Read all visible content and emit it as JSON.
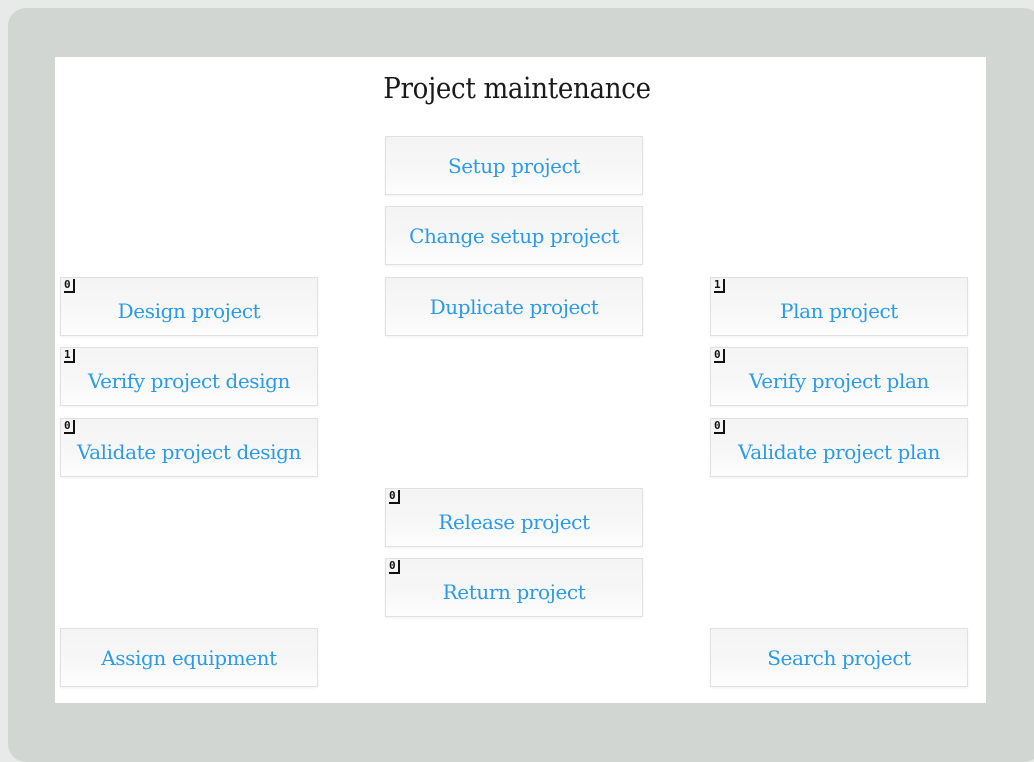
{
  "page": {
    "title": "Project maintenance"
  },
  "colors": {
    "link_text": "#2b9be8",
    "frame": "#d2d6d3",
    "panel": "#ffffff"
  },
  "tiles": {
    "setup_project": {
      "label": "Setup project"
    },
    "change_setup_project": {
      "label": "Change setup project"
    },
    "design_project": {
      "label": "Design project",
      "count": "0"
    },
    "duplicate_project": {
      "label": "Duplicate project"
    },
    "plan_project": {
      "label": "Plan project",
      "count": "1"
    },
    "verify_project_design": {
      "label": "Verify project design",
      "count": "1"
    },
    "verify_project_plan": {
      "label": "Verify project plan",
      "count": "0"
    },
    "validate_project_design": {
      "label": "Validate project design",
      "count": "0"
    },
    "validate_project_plan": {
      "label": "Validate project plan",
      "count": "0"
    },
    "release_project": {
      "label": "Release project",
      "count": "0"
    },
    "return_project": {
      "label": "Return project",
      "count": "0"
    },
    "assign_equipment": {
      "label": "Assign equipment"
    },
    "search_project": {
      "label": "Search project"
    }
  }
}
